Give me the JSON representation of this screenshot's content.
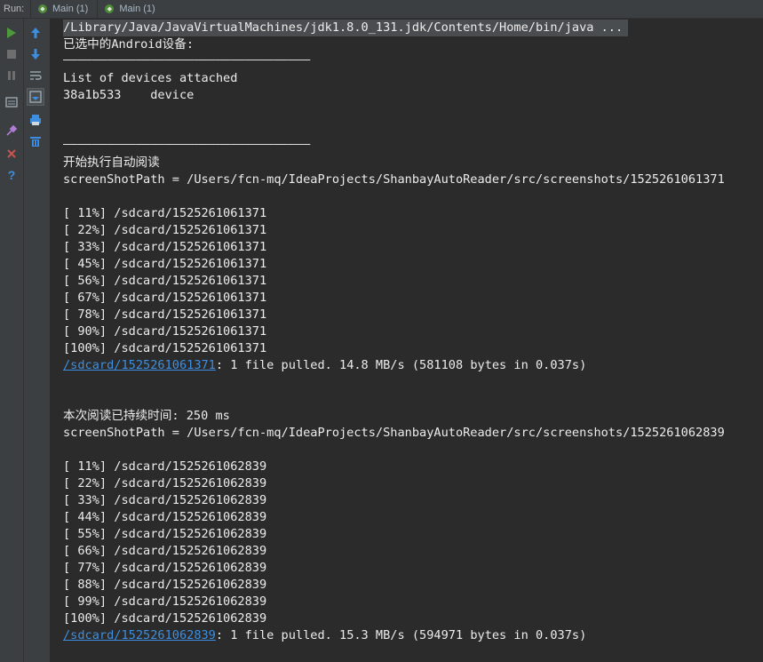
{
  "tabbar": {
    "run_label": "Run:",
    "tabs": [
      {
        "label": "Main (1)"
      },
      {
        "label": "Main (1)"
      }
    ]
  },
  "console": {
    "command": "/Library/Java/JavaVirtualMachines/jdk1.8.0_131.jdk/Contents/Home/bin/java ...",
    "selected_device_label": "已选中的Android设备:",
    "separator": "——————————————————————————————————",
    "devices_header": "List of devices attached",
    "device_line": "38a1b533    device",
    "start_reading": "开始执行自动阅读",
    "run1": {
      "screenshot_path": "screenShotPath = /Users/fcn-mq/IdeaProjects/ShanbayAutoReader/src/screenshots/1525261061371",
      "progress": [
        "[ 11%] /sdcard/1525261061371",
        "[ 22%] /sdcard/1525261061371",
        "[ 33%] /sdcard/1525261061371",
        "[ 45%] /sdcard/1525261061371",
        "[ 56%] /sdcard/1525261061371",
        "[ 67%] /sdcard/1525261061371",
        "[ 78%] /sdcard/1525261061371",
        "[ 90%] /sdcard/1525261061371",
        "[100%] /sdcard/1525261061371"
      ],
      "link": "/sdcard/1525261061371",
      "result": ": 1 file pulled. 14.8 MB/s (581108 bytes in 0.037s)"
    },
    "duration_line": "本次阅读已持续时间: 250 ms",
    "run2": {
      "screenshot_path": "screenShotPath = /Users/fcn-mq/IdeaProjects/ShanbayAutoReader/src/screenshots/1525261062839",
      "progress": [
        "[ 11%] /sdcard/1525261062839",
        "[ 22%] /sdcard/1525261062839",
        "[ 33%] /sdcard/1525261062839",
        "[ 44%] /sdcard/1525261062839",
        "[ 55%] /sdcard/1525261062839",
        "[ 66%] /sdcard/1525261062839",
        "[ 77%] /sdcard/1525261062839",
        "[ 88%] /sdcard/1525261062839",
        "[ 99%] /sdcard/1525261062839",
        "[100%] /sdcard/1525261062839"
      ],
      "link": "/sdcard/1525261062839",
      "result": ": 1 file pulled. 15.3 MB/s (594971 bytes in 0.037s)"
    }
  },
  "colors": {
    "background": "#2b2b2b",
    "toolbar": "#3c3f41",
    "text": "#ececec",
    "link": "#3d8ee0",
    "run_green": "#4e9a3a",
    "stop_red": "#c75450"
  }
}
